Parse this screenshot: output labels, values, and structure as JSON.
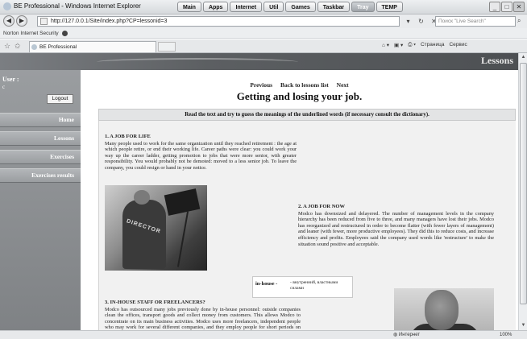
{
  "window": {
    "title": "BE Professional - Windows Internet Explorer",
    "task_buttons": [
      "Main",
      "Apps",
      "Internet",
      "Util",
      "Games",
      "Taskbar",
      "Tray",
      "TEMP"
    ],
    "active_task": "Tray"
  },
  "browser": {
    "url": "http://127.0.0.1/Site/index.php?CP=lessonid=3",
    "search_placeholder": "Поиск \"Live Search\"",
    "toolbar_label": "Norton Internet Security",
    "tab_label": "BE Professional",
    "command_bar": [
      "Страница",
      "Сервис"
    ],
    "status_zone": "Интернет",
    "zoom": "100%"
  },
  "site": {
    "header_title": "Lessons",
    "user_label": "User :",
    "user_name": "c",
    "logout_label": "Logout",
    "menu": [
      "Home",
      "Lessons",
      "Exercises",
      "Exercises results"
    ]
  },
  "lesson": {
    "nav_previous": "Previous",
    "nav_back": "Back to lessons list",
    "nav_next": "Next",
    "title": "Getting and losing your job.",
    "instruction": "Read the text and try to guess the meanings of the underlined words (if necessary consult the dictionary).",
    "sections": [
      {
        "heading": "1. A JOB FOR LIFE",
        "text": "Many people used to work for the same organization until they reached retirement : the age at which people retire, or end their working life. Career paths were clear: you could work your way up the career ladder, getting promotion to jobs that were more senior, with greater responsibility. You would probably not be demoted: moved to a less senior job. To leave the company, you could resign or hand in your notice."
      },
      {
        "heading": "2. A JOB FOR NOW",
        "text": "Modco has downsized and delayered. The number of management levels in the company hierarchy has been reduced from five to three, and many managers have lost their jobs. Modco has reorganized and restructured in order to become flatter (with fewer layers of management) and leaner (with fewer, more productive employees). They did this to reduce costs, and increase efficiency and profits. Employees said the company used words like 'restructure' to make the situation sound positive and acceptable."
      },
      {
        "heading": "3. IN-HOUSE STAFF OR FREELANCERS?",
        "text": "Modco has outsourced many jobs previously done by in-house personnel: outside companies clean the offices, transport goods and collect money from customers. This allows Modco to concentrate on its main business activities. Modco uses more freelancers, independent people who may work for several different companies, and they employ people for short periods on temporary contracts. Modco expects flexibility, with people moving to different jobs when necessary, but for many"
      }
    ],
    "photo_text": "DIRECTOR",
    "glossary": {
      "term": "in-house -",
      "definition": "- внутренний, властными силами"
    }
  }
}
